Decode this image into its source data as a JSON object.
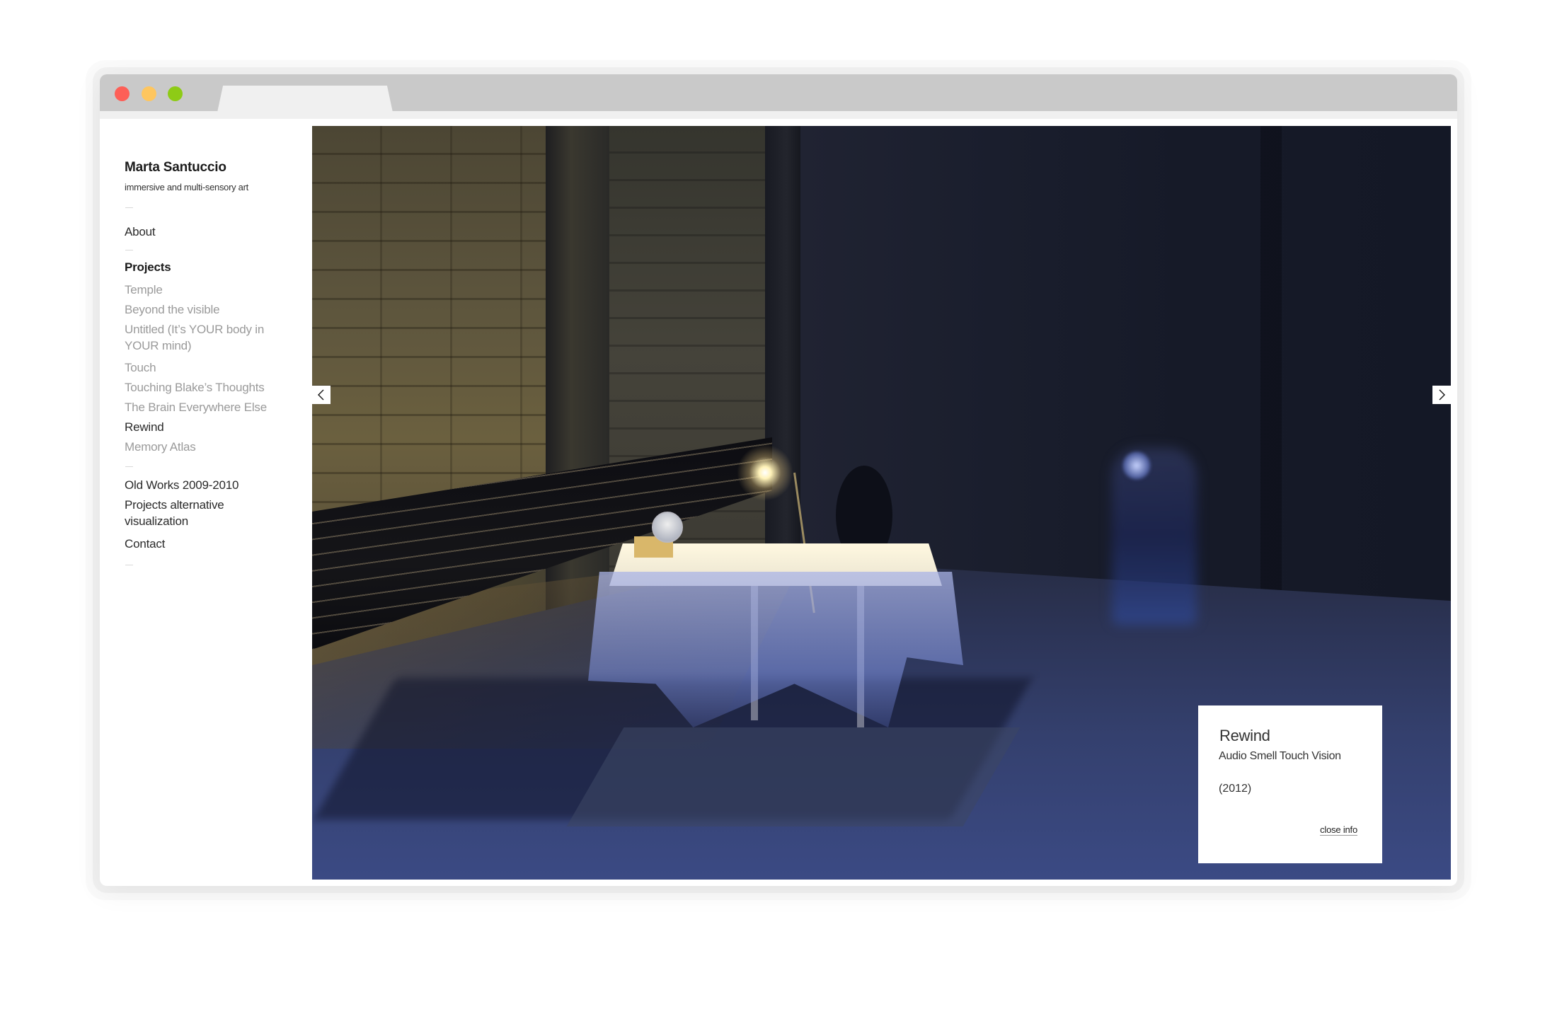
{
  "browser": {
    "window_controls": [
      "close",
      "minimize",
      "maximize"
    ],
    "colors": {
      "close": "#fd5f57",
      "minimize": "#fec65f",
      "maximize": "#8ecb16",
      "chrome": "#c9c9c9",
      "tab": "#f0f0f0"
    }
  },
  "site": {
    "title": "Marta Santuccio",
    "tagline": "immersive and multi-sensory art"
  },
  "nav": {
    "about": "About",
    "projects_heading": "Projects",
    "projects": [
      {
        "label": "Temple",
        "active": false
      },
      {
        "label": "Beyond the visible",
        "active": false
      },
      {
        "label": "Untitled (It’s YOUR body in YOUR mind)",
        "active": false
      },
      {
        "label": "Touch",
        "active": false
      },
      {
        "label": "Touching Blake’s Thoughts",
        "active": false
      },
      {
        "label": "The Brain Everywhere Else",
        "active": false
      },
      {
        "label": "Rewind",
        "active": true
      },
      {
        "label": "Memory Atlas",
        "active": false
      }
    ],
    "extra": [
      "Old Works 2009-2010",
      "Projects alternative visualization",
      "Contact"
    ]
  },
  "viewer": {
    "prev_icon": "chevron-left-icon",
    "next_icon": "chevron-right-icon",
    "image_description": "Dimly lit warehouse installation with a table draped in translucent plastic, a desk lamp, hanging black plastic strands, and a blurred walking figure"
  },
  "info": {
    "title": "Rewind",
    "subtitle": "Audio Smell Touch Vision",
    "year": "(2012)",
    "close_label": "close info"
  }
}
